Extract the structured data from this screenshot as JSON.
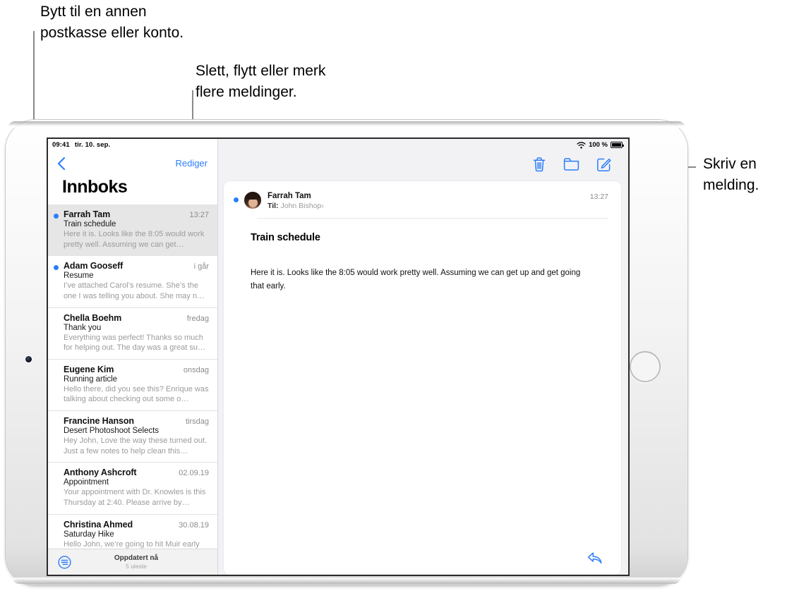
{
  "callouts": [
    {
      "id": "callout-mailbox",
      "text": "Bytt til en annen\npostkasse eller konto."
    },
    {
      "id": "callout-edit",
      "text": "Slett, flytt eller merk\nflere meldinger."
    },
    {
      "id": "callout-compose",
      "text": "Skriv en\nmelding."
    }
  ],
  "statusbar": {
    "time": "09:41",
    "date": "tir. 10. sep.",
    "battery_percent": "100 %",
    "wifi_icon": "wifi-icon",
    "battery_icon": "battery-icon"
  },
  "sidebar": {
    "back_icon": "back-chevron-icon",
    "edit_label": "Rediger",
    "title": "Innboks",
    "messages": [
      {
        "sender": "Farrah Tam",
        "date": "13:27",
        "subject": "Train schedule",
        "preview": "Here it is. Looks like the 8:05 would work pretty well. Assuming we can get…",
        "unread": true,
        "selected": true
      },
      {
        "sender": "Adam Gooseff",
        "date": "i går",
        "subject": "Resume",
        "preview": "I’ve attached Carol’s resume. She’s the one I was telling you about. She may n…",
        "unread": true,
        "selected": false
      },
      {
        "sender": "Chella Boehm",
        "date": "fredag",
        "subject": "Thank you",
        "preview": "Everything was perfect! Thanks so much for helping out. The day was a great su…",
        "unread": false,
        "selected": false
      },
      {
        "sender": "Eugene Kim",
        "date": "onsdag",
        "subject": "Running article",
        "preview": "Hello there, did you see this? Enrique was talking about checking out some o…",
        "unread": false,
        "selected": false
      },
      {
        "sender": "Francine Hanson",
        "date": "tirsdag",
        "subject": "Desert Photoshoot Selects",
        "preview": "Hey John, Love the way these turned out. Just a few notes to help clean this…",
        "unread": false,
        "selected": false
      },
      {
        "sender": "Anthony Ashcroft",
        "date": "02.09.19",
        "subject": "Appointment",
        "preview": "Your appointment with Dr. Knowles is this Thursday at 2:40. Please arrive by…",
        "unread": false,
        "selected": false
      },
      {
        "sender": "Christina Ahmed",
        "date": "30.08.19",
        "subject": "Saturday Hike",
        "preview": "Hello John, we’re going to hit Muir early",
        "unread": false,
        "selected": false
      }
    ],
    "footer": {
      "filter_icon": "filter-icon",
      "status": "Oppdatert nå",
      "unread": "5 uleste"
    }
  },
  "detail": {
    "toolbar": {
      "trash_icon": "trash-icon",
      "folder_icon": "folder-icon",
      "compose_icon": "compose-icon"
    },
    "message": {
      "avatar": "avatar",
      "from": "Farrah Tam",
      "to_label": "Til:",
      "to_name": "John Bishop",
      "to_chevron": "›",
      "time": "13:27",
      "subject": "Train schedule",
      "body": "Here it is. Looks like the 8:05 would work pretty well. Assuming we can get up and get going that early."
    },
    "reply_icon": "reply-icon"
  },
  "colors": {
    "accent": "#2b7dfa",
    "selected_row": "#e6e6e6",
    "detail_bg": "#f2f2f5"
  }
}
